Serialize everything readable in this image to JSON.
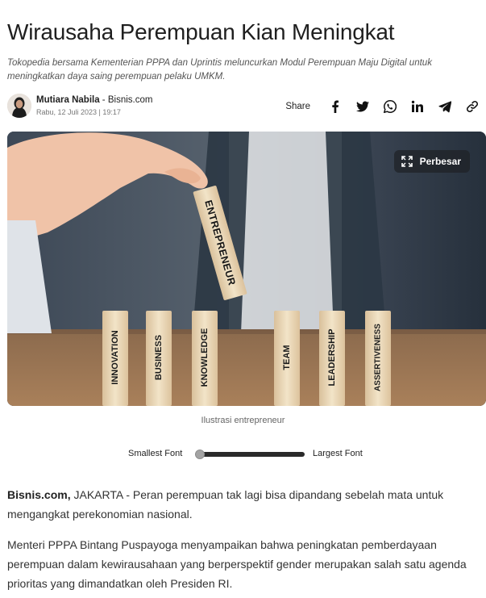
{
  "article": {
    "title": "Wirausaha Perempuan Kian Meningkat",
    "summary": "Tokopedia bersama Kementerian PPPA dan Uprintis meluncurkan Modul Perempuan Maju Digital untuk meningkatkan daya saing perempuan pelaku UMKM.",
    "author": "Mutiara Nabila",
    "author_sep": " - ",
    "outlet": "Bisnis.com",
    "date": "Rabu, 12 Juli 2023 | 19:17"
  },
  "share": {
    "label": "Share",
    "buttons": [
      "facebook-icon",
      "twitter-icon",
      "whatsapp-icon",
      "linkedin-icon",
      "telegram-icon",
      "link-icon"
    ]
  },
  "image": {
    "zoom_label": "Perbesar",
    "zoom_icon": "expand-icon",
    "blocks": [
      "INNOVATION",
      "BUSINESS",
      "KNOWLEDGE",
      "TEAM",
      "LEADERSHIP",
      "ASSERTIVENESS"
    ],
    "held_block": "ENTREPRENEUR",
    "caption": "Ilustrasi entrepreneur"
  },
  "font_control": {
    "smallest_label": "Smallest Font",
    "largest_label": "Largest Font",
    "level": 0
  },
  "body": {
    "p1_source": "Bisnis.com,",
    "p1_text": " JAKARTA - Peran perempuan tak lagi bisa dipandang sebelah mata untuk mengangkat perekonomian nasional.",
    "p2_text": "Menteri PPPA Bintang Puspayoga menyampaikan bahwa peningkatan pemberdayaan perempuan dalam kewirausahaan yang berperspektif gender merupakan salah satu agenda prioritas yang dimandatkan oleh Presiden RI."
  },
  "colors": {
    "text": "#222222",
    "muted": "#777777",
    "slider_track": "#2a2a2a",
    "slider_thumb": "#a3a3a3"
  }
}
